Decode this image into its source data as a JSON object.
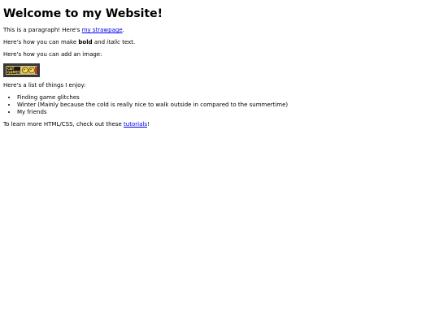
{
  "heading": "Welcome to my Website!",
  "intro": {
    "text_before": "This is a paragraph! Here's ",
    "link": "my strawpage",
    "text_after": "."
  },
  "formatting": {
    "text_before": "Here's how you can make ",
    "bold": "bold",
    "middle": " and ",
    "italic": "italic",
    "text_after": " text."
  },
  "image_intro": "Here's how you can add an image:",
  "image_badge_text": "CAT GAMES",
  "list_intro": "Here's a list of things I enjoy:",
  "list_items": [
    "Finding game glitches",
    "Winter (Mainly because the cold is really nice to walk outside in compared to the summertime)",
    "My friends"
  ],
  "outro": {
    "text_before": "To learn more HTML/CSS, check out these ",
    "link": "tutorials",
    "text_after": "!"
  },
  "colors": {
    "link": "#0000ee",
    "text": "#000000",
    "background": "#ffffff"
  }
}
